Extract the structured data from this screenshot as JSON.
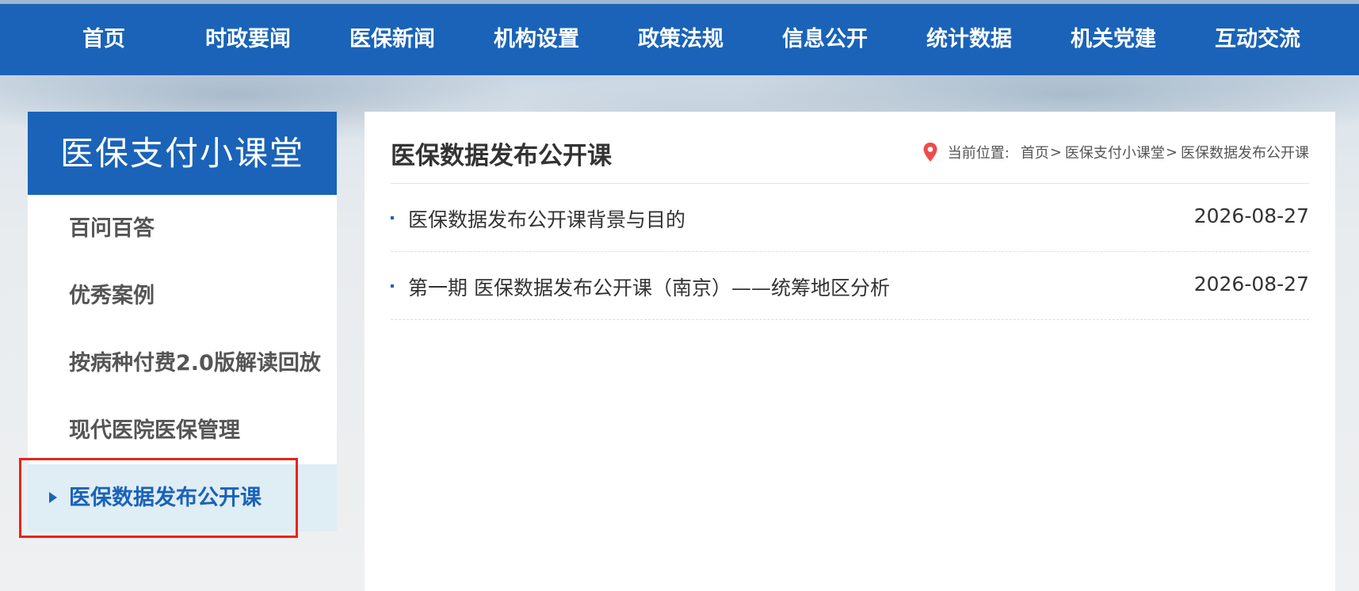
{
  "topnav": {
    "items": [
      "首页",
      "时政要闻",
      "医保新闻",
      "机构设置",
      "政策法规",
      "信息公开",
      "统计数据",
      "机关党建",
      "互动交流"
    ]
  },
  "sidebar": {
    "title": "医保支付小课堂",
    "items": [
      {
        "label": "百问百答"
      },
      {
        "label": "优秀案例"
      },
      {
        "label": "按病种付费2.0版解读回放"
      },
      {
        "label": "现代医院医保管理"
      },
      {
        "label": "医保数据发布公开课"
      }
    ],
    "active_index": 4
  },
  "content": {
    "title": "医保数据发布公开课",
    "breadcrumb": {
      "label": "当前位置:",
      "crumbs": [
        "首页",
        "医保支付小课堂",
        "医保数据发布公开课"
      ],
      "separator": ">"
    },
    "articles": [
      {
        "title": "医保数据发布公开课背景与目的",
        "date": "2026-08-27"
      },
      {
        "title": "第一期 医保数据发布公开课（南京）——统筹地区分析",
        "date": "2026-08-27"
      }
    ]
  },
  "colors": {
    "brand_blue": "#1a63b8",
    "highlight_red": "#e8231e",
    "pin_red": "#ef4b4b"
  },
  "icons": {
    "breadcrumb": "location-pin-icon",
    "active_item": "triangle-right-icon"
  }
}
